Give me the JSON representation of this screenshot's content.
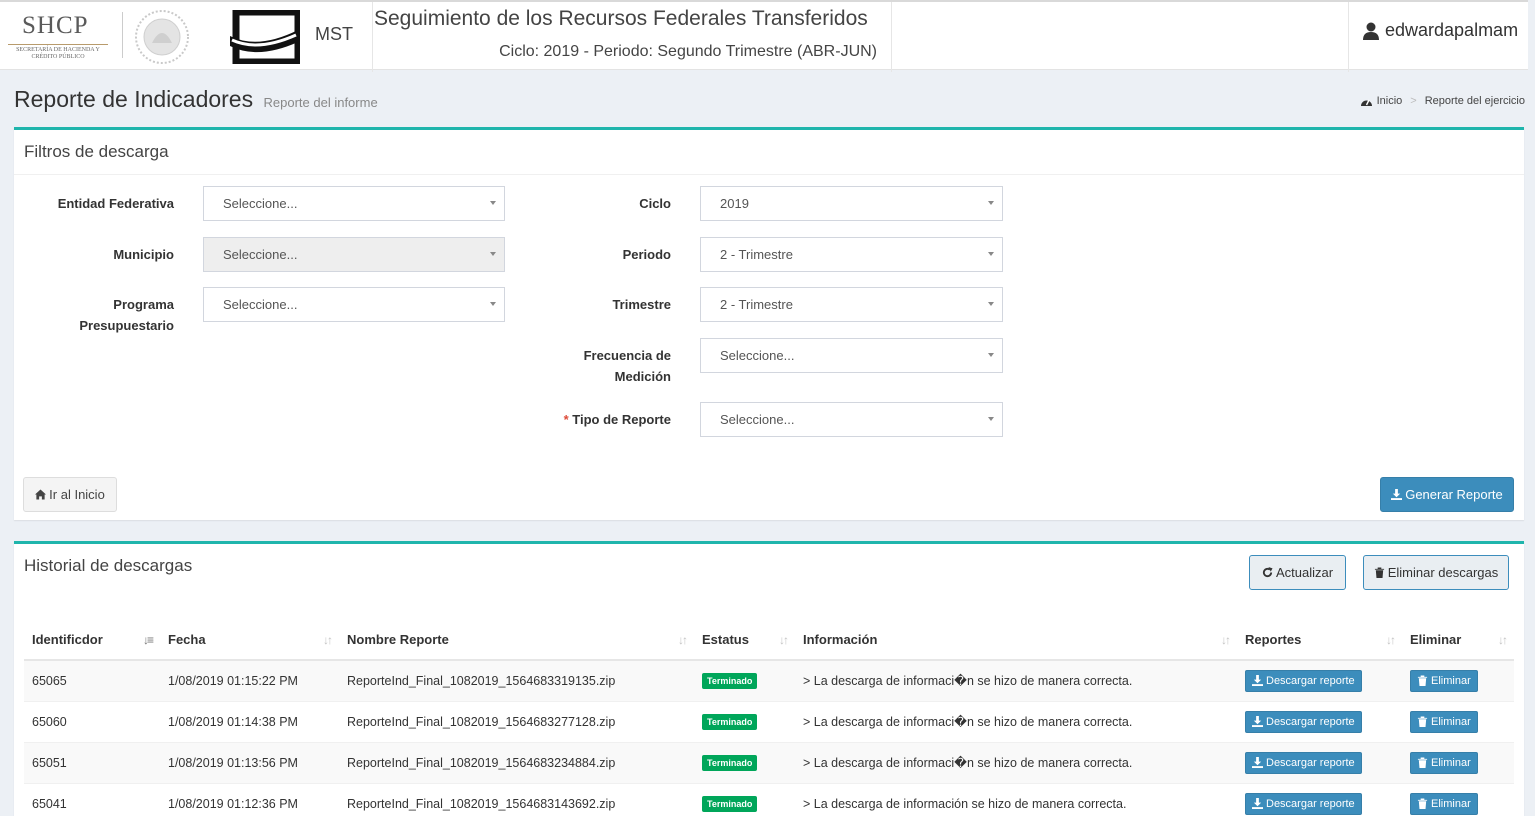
{
  "header": {
    "shcp_logo": "SHCP",
    "shcp_sub": "SECRETARÍA DE HACIENDA Y CRÉDITO PÚBLICO",
    "mst_label": "MST",
    "title": "Seguimiento de los Recursos Federales Transferidos",
    "subtitle": "Ciclo: 2019 - Periodo: Segundo Trimestre (ABR-JUN)",
    "username": "edwardapalmam"
  },
  "page": {
    "title": "Reporte de Indicadores",
    "subtitle": "Reporte del informe",
    "breadcrumb": [
      "Inicio",
      "Reporte del ejercicio"
    ]
  },
  "filters": {
    "box_title": "Filtros de descarga",
    "entidad_label": "Entidad Federativa",
    "entidad_value": "Seleccione...",
    "municipio_label": "Municipio",
    "municipio_value": "Seleccione...",
    "programa_label_1": "Programa",
    "programa_label_2": "Presupuestario",
    "programa_value": "Seleccione...",
    "ciclo_label": "Ciclo",
    "ciclo_value": "2019",
    "periodo_label": "Periodo",
    "periodo_value": "2 - Trimestre",
    "trimestre_label": "Trimestre",
    "trimestre_value": "2 - Trimestre",
    "frecuencia_label_1": "Frecuencia de",
    "frecuencia_label_2": "Medición",
    "frecuencia_value": "Seleccione...",
    "tipo_required": "*",
    "tipo_label": "Tipo de Reporte",
    "tipo_value": "Seleccione...",
    "home_button": "Ir al Inicio",
    "generate_button": "Generar Reporte"
  },
  "history": {
    "box_title": "Historial de descargas",
    "refresh_button": "Actualizar",
    "delete_all_button": "Eliminar descargas",
    "columns": [
      "Identificdor",
      "Fecha",
      "Nombre Reporte",
      "Estatus",
      "Información",
      "Reportes",
      "Eliminar"
    ],
    "rows": [
      {
        "id": "65065",
        "fecha": "1/08/2019 01:15:22 PM",
        "nombre": "ReporteInd_Final_1082019_1564683319135.zip",
        "estatus": "Terminado",
        "info": "> La descarga de informaci�n se hizo de manera correcta.",
        "download": "Descargar reporte",
        "delete": "Eliminar"
      },
      {
        "id": "65060",
        "fecha": "1/08/2019 01:14:38 PM",
        "nombre": "ReporteInd_Final_1082019_1564683277128.zip",
        "estatus": "Terminado",
        "info": "> La descarga de informaci�n se hizo de manera correcta.",
        "download": "Descargar reporte",
        "delete": "Eliminar"
      },
      {
        "id": "65051",
        "fecha": "1/08/2019 01:13:56 PM",
        "nombre": "ReporteInd_Final_1082019_1564683234884.zip",
        "estatus": "Terminado",
        "info": "> La descarga de informaci�n se hizo de manera correcta.",
        "download": "Descargar reporte",
        "delete": "Eliminar"
      },
      {
        "id": "65041",
        "fecha": "1/08/2019 01:12:36 PM",
        "nombre": "ReporteInd_Final_1082019_1564683143692.zip",
        "estatus": "Terminado",
        "info": "> La descarga de información se hizo de manera correcta.",
        "download": "Descargar reporte",
        "delete": "Eliminar"
      }
    ]
  },
  "colors": {
    "accent": "#1fb5ac",
    "primary": "#3c8dbc",
    "success": "#00a65a"
  }
}
